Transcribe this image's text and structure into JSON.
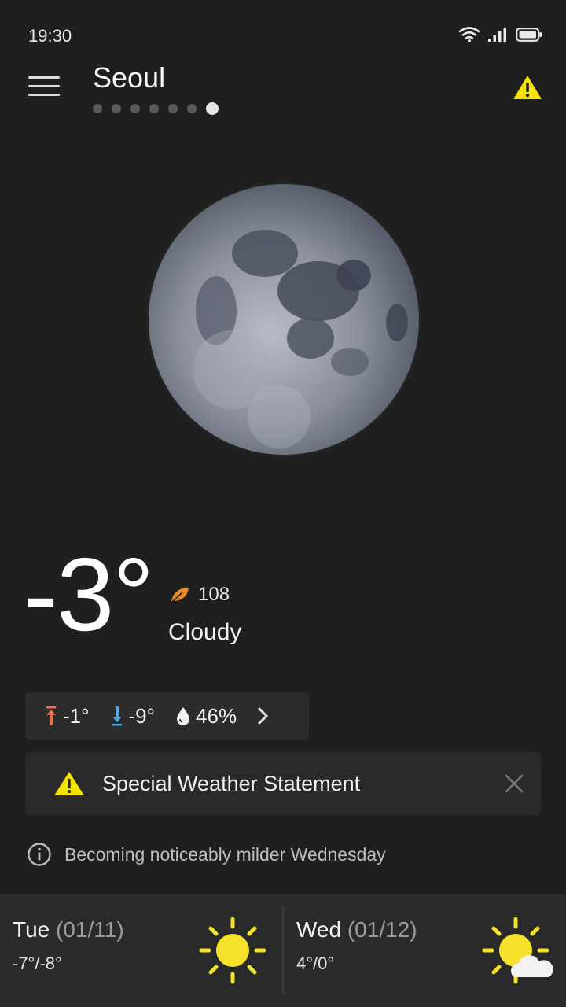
{
  "status": {
    "time": "19:30"
  },
  "header": {
    "city": "Seoul",
    "page_count": 7,
    "active_page": 6
  },
  "current": {
    "temperature": "-3°",
    "aqi": "108",
    "condition": "Cloudy"
  },
  "details": {
    "high": "-1°",
    "low": "-9°",
    "humidity": "46%"
  },
  "alert": {
    "title": "Special Weather Statement"
  },
  "info": {
    "text": "Becoming noticeably milder Wednesday"
  },
  "forecast": [
    {
      "day": "Tue",
      "date": "(01/11)",
      "temps": "-7°/-8°",
      "icon": "sun-icon"
    },
    {
      "day": "Wed",
      "date": "(01/12)",
      "temps": "4°/0°",
      "icon": "sun-cloud-icon"
    }
  ],
  "colors": {
    "background": "#1f1f1f",
    "warning_yellow": "#f4e400",
    "high_arrow": "#e8734f",
    "low_arrow": "#4da9e0",
    "aqi_leaf": "#ea8a2e",
    "sun": "#f3e12a"
  }
}
